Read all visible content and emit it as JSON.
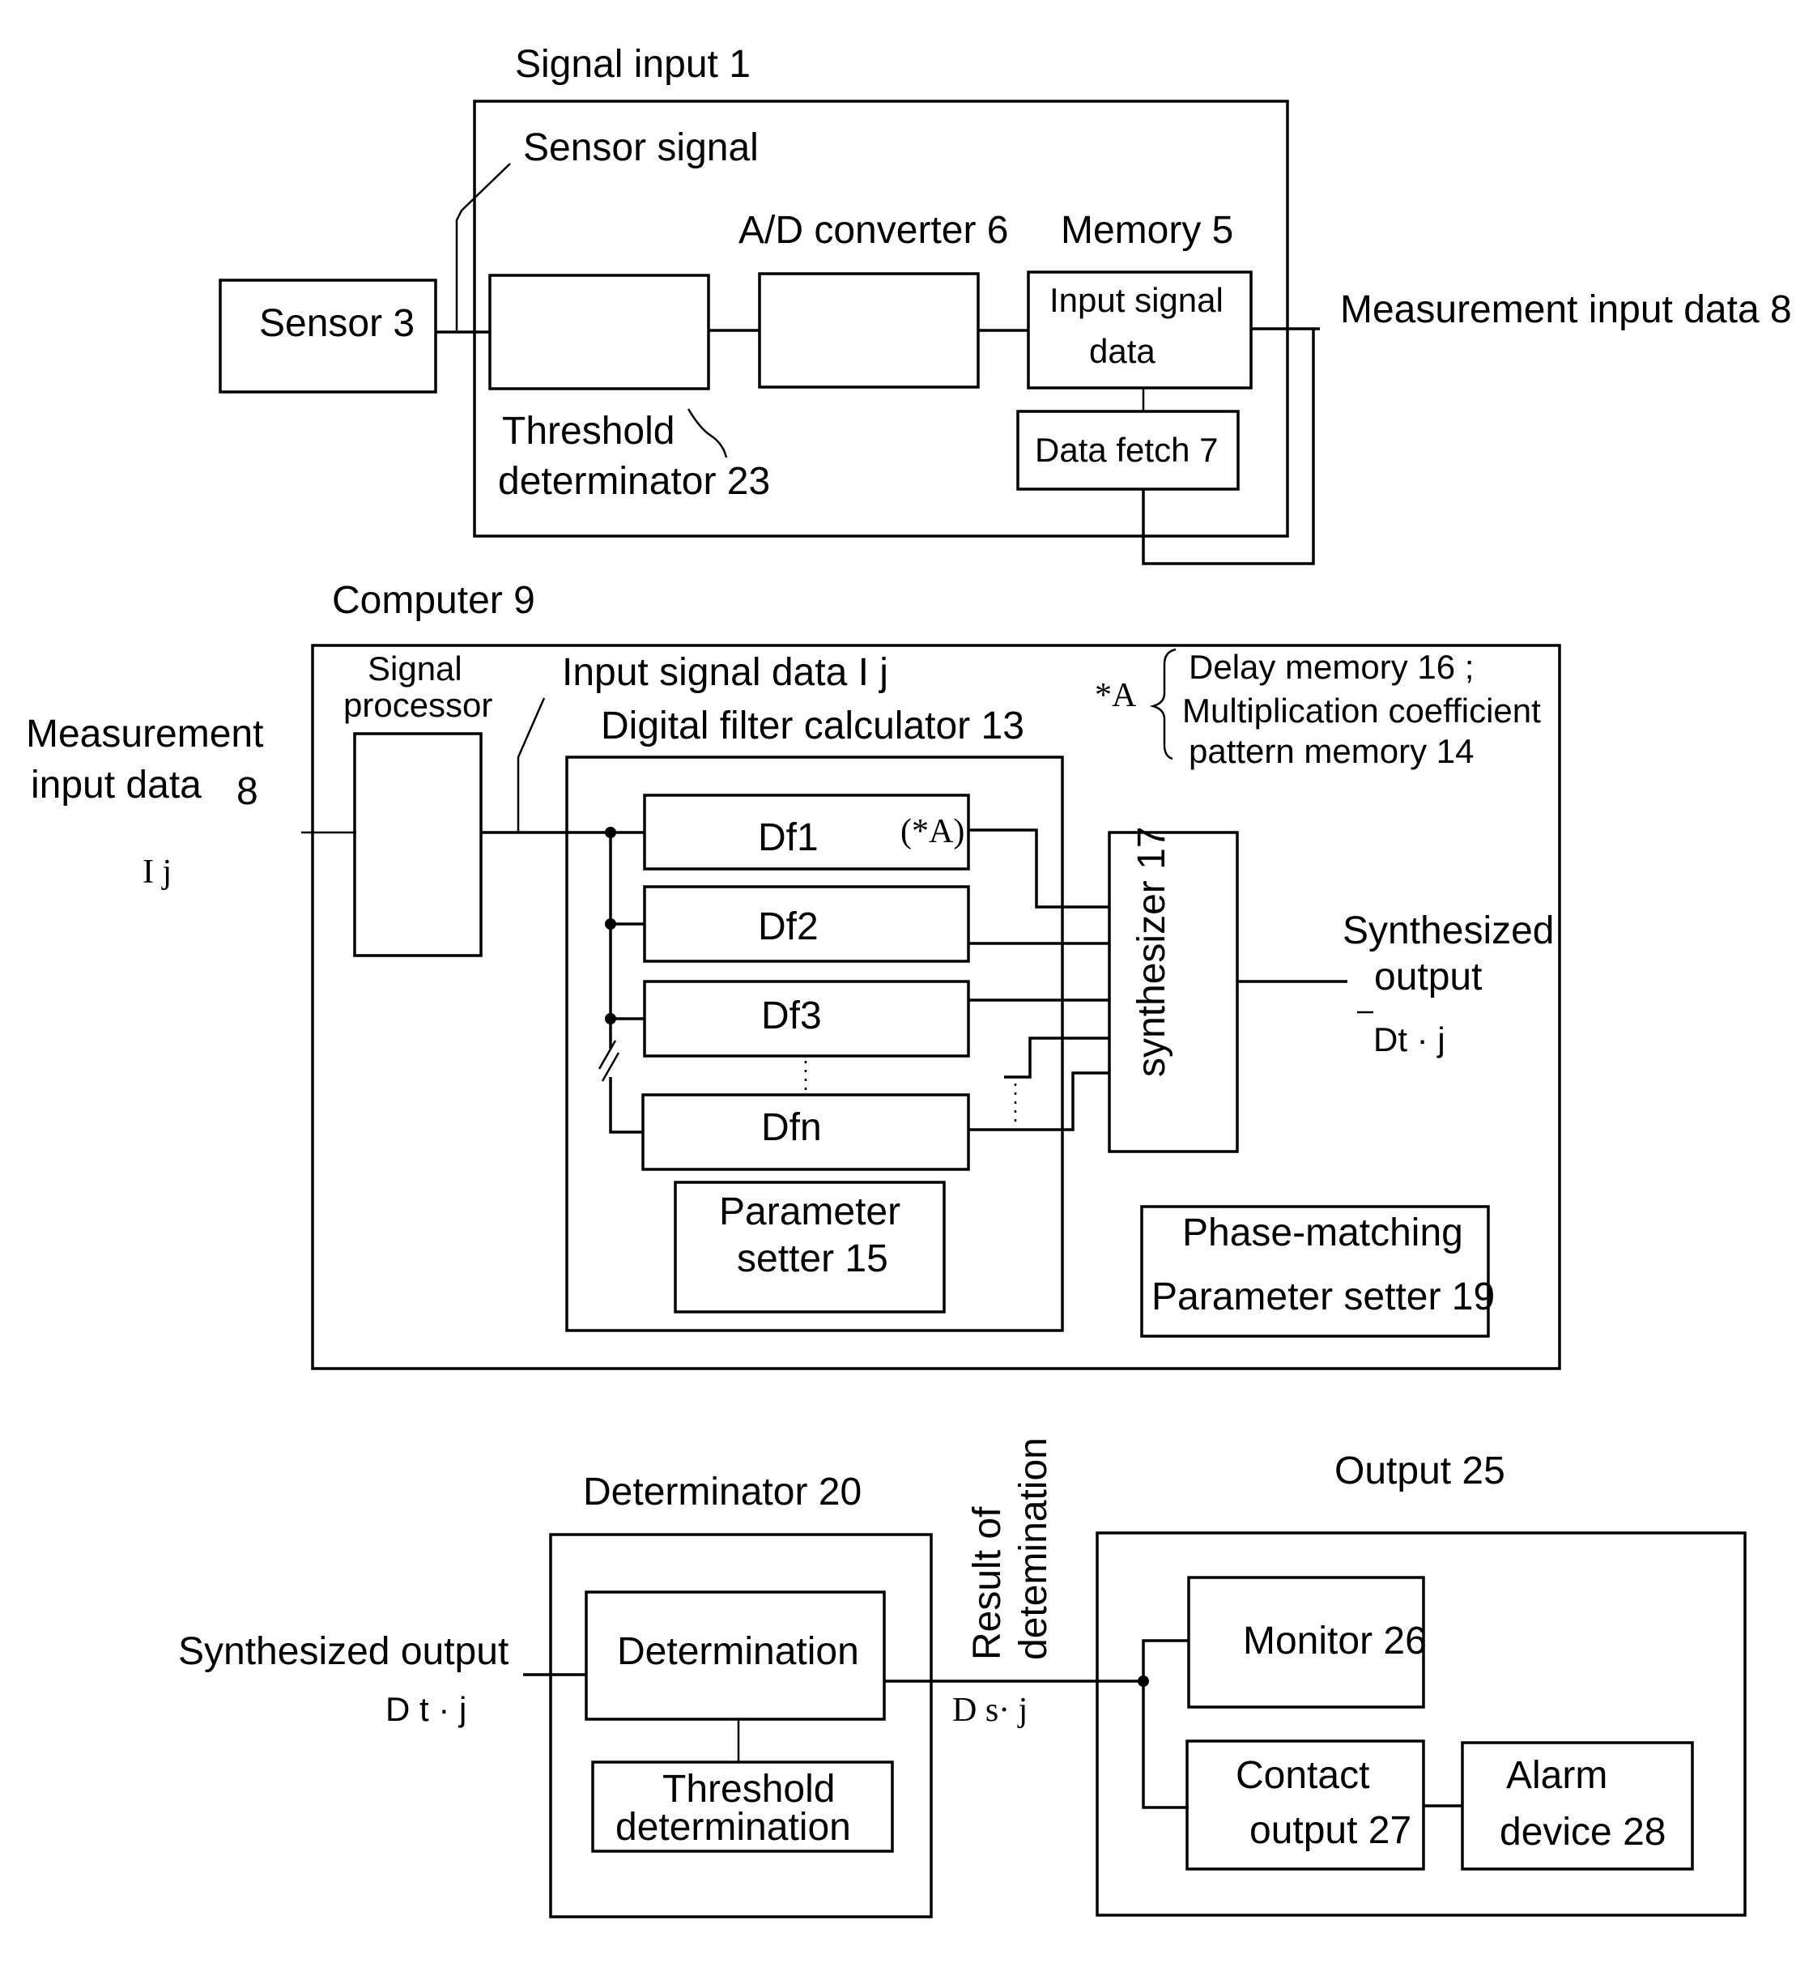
{
  "signal_input": {
    "title": "Signal input 1",
    "sensor_signal": "Sensor signal",
    "sensor": "Sensor 3",
    "ad_converter": "A/D converter 6",
    "memory": "Memory 5",
    "memory_content_line1": "Input signal",
    "memory_content_line2": "data",
    "data_fetch": "Data fetch 7",
    "threshold_line1": "Threshold",
    "threshold_line2": "determinator 23",
    "output_label": "Measurement input data 8"
  },
  "computer": {
    "title": "Computer 9",
    "input_label_line1": "Measurement",
    "input_label_line2": "input data",
    "input_label_num": "8",
    "input_symbol": "I  j",
    "signal_processor_line1": "Signal",
    "signal_processor_line2": "processor",
    "input_signal_data": "Input signal data I j",
    "digital_filter_calculator": "Digital filter calculator 13",
    "filters": [
      "Df1",
      "Df2",
      "Df3",
      "Dfn"
    ],
    "filter1_note": "(*A)",
    "note_marker": "*A",
    "note_line1": "Delay memory 16 ;",
    "note_line2": "Multiplication coefficient",
    "note_line3": "pattern memory 14",
    "parameter_setter_line1": "Parameter",
    "parameter_setter_line2": "setter 15",
    "synthesizer": "synthesizer 17",
    "synth_output_line1": "Synthesized",
    "synth_output_line2": "output",
    "synth_output_symbol": "Dt · j",
    "phase_matching_line1": "Phase-matching",
    "phase_matching_line2": "Parameter setter 19"
  },
  "determinator": {
    "title": "Determinator  20",
    "input_label": "Synthesized output",
    "input_symbol": "D  t  ·  j",
    "determination": "Determination",
    "threshold_line1": "Threshold",
    "threshold_line2": "determination",
    "result_line1": "Result of",
    "result_line2": "detemination",
    "result_symbol": "D s·  j"
  },
  "output": {
    "title": "Output  25",
    "monitor": "Monitor 26",
    "contact_line1": "Contact",
    "contact_line2": "output 27",
    "alarm_line1": "Alarm",
    "alarm_line2": "device  28"
  }
}
